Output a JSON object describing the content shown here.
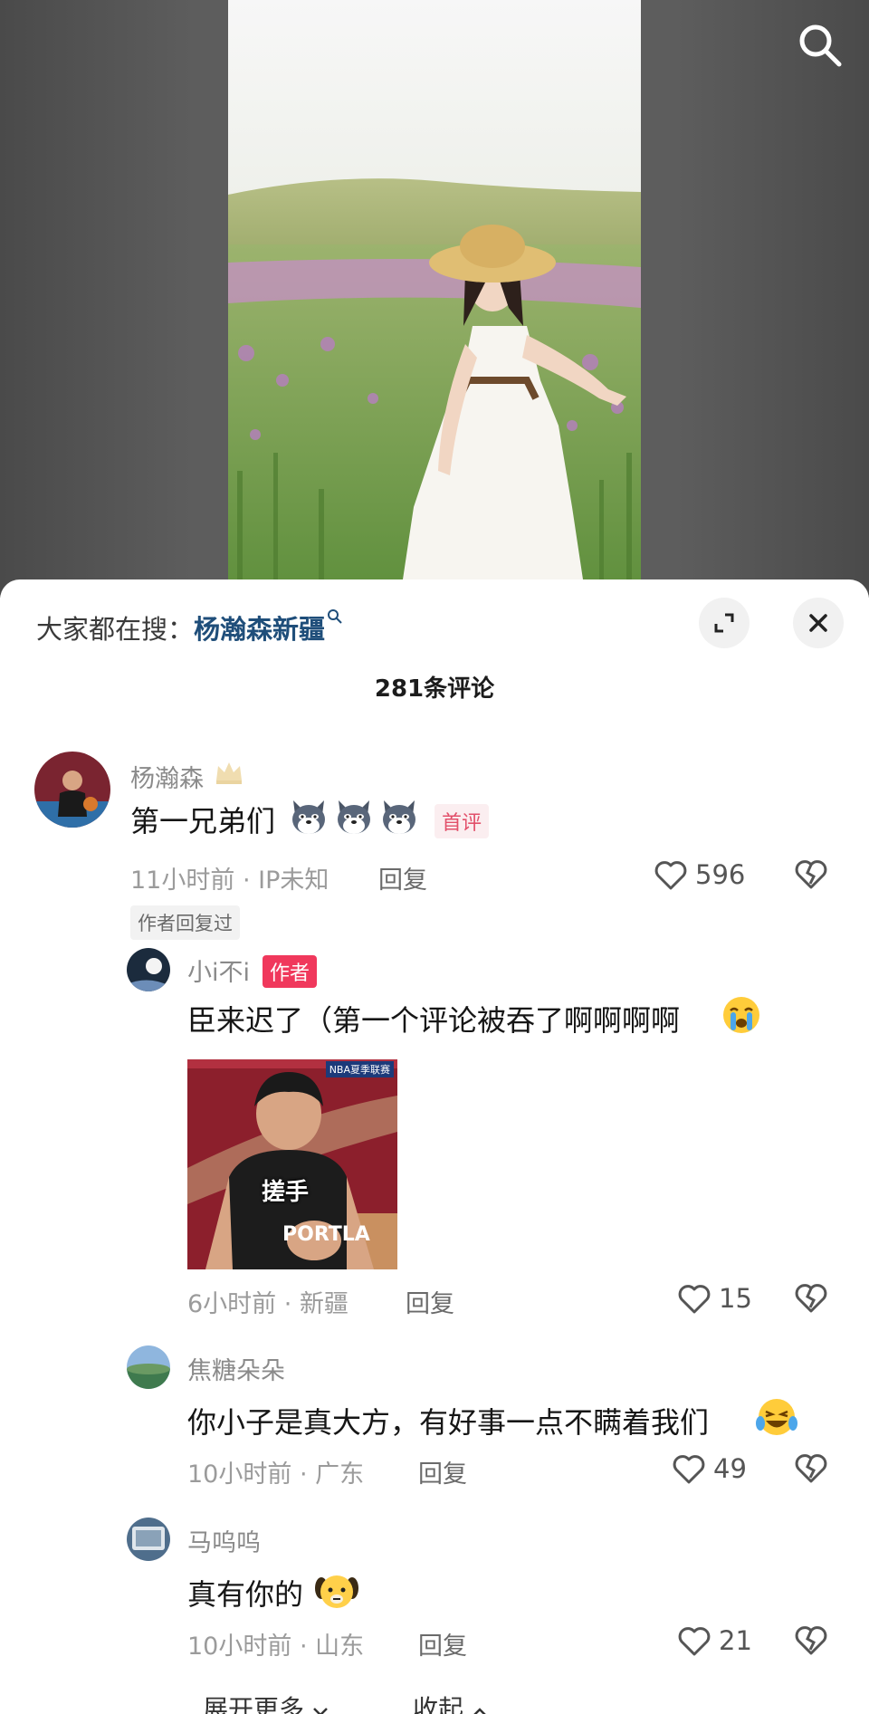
{
  "hot_search": {
    "prefix": "大家都在搜：",
    "keyword": "杨瀚森新疆"
  },
  "comment_count": "281条评论",
  "comments": [
    {
      "author": "杨瀚森",
      "text": "第一兄弟们",
      "emoji": [
        "wolf-emoji",
        "wolf-emoji",
        "wolf-emoji"
      ],
      "badge": "首评",
      "time": "11小时前",
      "location": "IP未知",
      "reply_label": "回复",
      "likes": "596",
      "replied_tag": "作者回复过"
    },
    {
      "author": "小i不i",
      "author_badge": "作者",
      "text": "臣来迟了（第一个评论被吞了啊啊啊啊",
      "emoji": [
        "crying-emoji"
      ],
      "sticker_caption": "搓手",
      "sticker_overlay": "NBA夏季联赛",
      "time": "6小时前",
      "location": "新疆",
      "reply_label": "回复",
      "likes": "15"
    },
    {
      "author": "焦糖朵朵",
      "text": "你小子是真大方，有好事一点不瞒着我们",
      "emoji": [
        "laughing-tears-emoji"
      ],
      "time": "10小时前",
      "location": "广东",
      "reply_label": "回复",
      "likes": "49"
    },
    {
      "author": "马呜呜",
      "text": "真有你的",
      "emoji": [
        "dog-emoji"
      ],
      "time": "10小时前",
      "location": "山东",
      "reply_label": "回复",
      "likes": "21"
    }
  ],
  "footer": {
    "expand_more": "展开更多",
    "collapse": "收起"
  }
}
